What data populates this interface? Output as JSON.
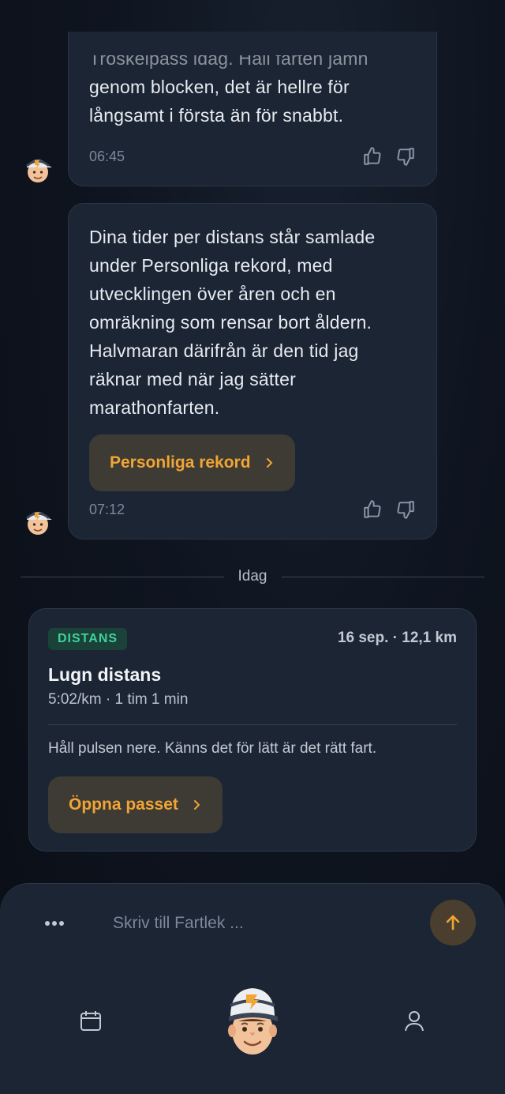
{
  "messages": [
    {
      "lines_faded": "Tröskelpass idag. Håll farten jämn",
      "text": "genom blocken, det är hellre för långsamt i första än för snabbt.",
      "time": "06:45"
    },
    {
      "text": "Dina tider per distans står samlade under Personliga rekord, med utvecklingen över åren och en omräkning som rensar bort åldern. Halvmaran därifrån är den tid jag räknar med när jag sätter marathonfarten.",
      "button": "Personliga rekord",
      "time": "07:12"
    }
  ],
  "divider": {
    "label": "Idag"
  },
  "workout": {
    "tag": "DISTANS",
    "date_distance": "16 sep. · 12,1 km",
    "title": "Lugn distans",
    "pace_duration": "5:02/km · 1 tim 1 min",
    "description": "Håll pulsen nere. Känns det för lätt är det rätt fart.",
    "button": "Öppna passet"
  },
  "composer": {
    "placeholder": "Skriv till Fartlek ..."
  },
  "colors": {
    "accent": "#f0a535",
    "tag_text": "#3ed29a",
    "card_bg": "#1b2534"
  },
  "icons": [
    "mascot-avatar-icon",
    "thumbs-up-icon",
    "thumbs-down-icon",
    "chevron-right-icon",
    "more-dots-icon",
    "arrow-up-icon",
    "calendar-icon",
    "user-icon"
  ]
}
